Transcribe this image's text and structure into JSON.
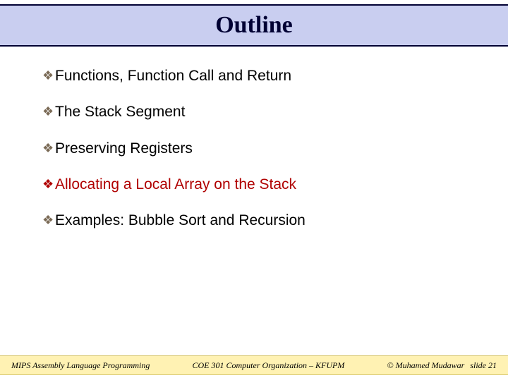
{
  "title": "Outline",
  "bullets": [
    {
      "text": "Functions, Function Call and Return",
      "active": false
    },
    {
      "text": "The Stack Segment",
      "active": false
    },
    {
      "text": "Preserving Registers",
      "active": false
    },
    {
      "text": "Allocating a Local Array on the Stack",
      "active": true
    },
    {
      "text": "Examples: Bubble Sort and Recursion",
      "active": false
    }
  ],
  "footer": {
    "left": "MIPS Assembly Language Programming",
    "mid": "COE 301 Computer Organization – KFUPM",
    "author": "© Muhamed Mudawar",
    "slide": "slide 21"
  }
}
